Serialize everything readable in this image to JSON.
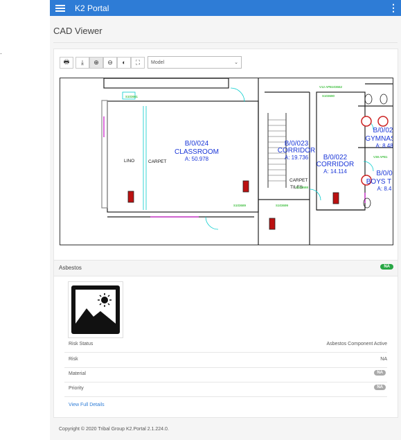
{
  "app": {
    "title": "K2 Portal",
    "margin_mark": "."
  },
  "page": {
    "title": "CAD Viewer"
  },
  "toolbar": {
    "buttons": [
      {
        "name": "print-icon",
        "glyph": "🖶"
      },
      {
        "name": "download-icon",
        "glyph": "⤓"
      },
      {
        "name": "zoom-in-icon",
        "glyph": "⊕"
      },
      {
        "name": "zoom-out-icon",
        "glyph": "⊖"
      },
      {
        "name": "contrast-icon",
        "glyph": "◐"
      },
      {
        "name": "fullscreen-icon",
        "glyph": "⛶"
      }
    ],
    "model_select": {
      "selected": "Model"
    }
  },
  "cad": {
    "rooms": [
      {
        "code": "B/0/024",
        "name": "CLASSROOM",
        "area": "A: 50.978"
      },
      {
        "code": "B/0/023",
        "name": "CORRIDOR",
        "area": "A: 19.736"
      },
      {
        "code": "B/0/022",
        "name": "CORRIDOR",
        "area": "A: 14.114"
      },
      {
        "code": "B/0/02",
        "name": "GYMNAS",
        "area": "A: 8.48"
      },
      {
        "code": "B/0/0",
        "name": "BOYS T",
        "area": "A: 8.4"
      }
    ],
    "labels": {
      "lino": "LINO",
      "carpet1": "CARPET",
      "carpet2": "CARPET",
      "tiles": "TILES",
      "tag1": "S103661",
      "tag2": "S103690",
      "tag3": "V12 APB103662",
      "tag4": "S103689",
      "tag5": "S103699",
      "tag6": "V38 APB1",
      "tag7": "S103688"
    }
  },
  "asbestos": {
    "title": "Asbestos",
    "status_badge": "NA",
    "rows": [
      {
        "label": "Risk Status",
        "value": "Asbestos Component Active"
      },
      {
        "label": "Risk",
        "value": "NA"
      },
      {
        "label": "Material",
        "badge": "NA"
      },
      {
        "label": "Priority",
        "badge": "NA"
      }
    ],
    "link": "View Full Details"
  },
  "footer": {
    "text": "Copyright © 2020 Tribal Group   K2.Portal 2.1.224.0."
  }
}
